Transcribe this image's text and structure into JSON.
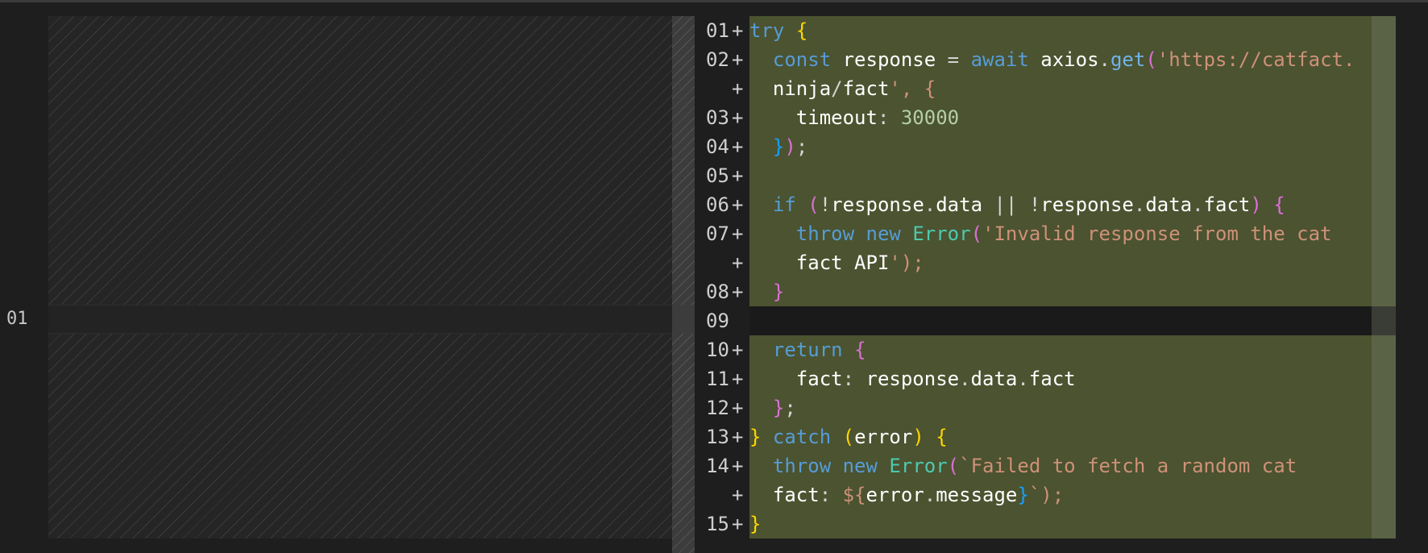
{
  "left_pane": {
    "line_number": "01"
  },
  "right_pane": {
    "lines": [
      {
        "num": "01",
        "marker": "+",
        "text": "try {"
      },
      {
        "num": "02",
        "marker": "+",
        "text": "  const response = await axios.get('https://catfact."
      },
      {
        "num": "",
        "marker": "+",
        "text": "  ninja/fact', {"
      },
      {
        "num": "03",
        "marker": "+",
        "text": "    timeout: 30000"
      },
      {
        "num": "04",
        "marker": "+",
        "text": "  });"
      },
      {
        "num": "05",
        "marker": "+",
        "text": ""
      },
      {
        "num": "06",
        "marker": "+",
        "text": "  if (!response.data || !response.data.fact) {"
      },
      {
        "num": "07",
        "marker": "+",
        "text": "    throw new Error('Invalid response from the cat"
      },
      {
        "num": "",
        "marker": "+",
        "text": "    fact API');"
      },
      {
        "num": "08",
        "marker": "+",
        "text": "  }"
      },
      {
        "num": "09",
        "marker": "",
        "text": ""
      },
      {
        "num": "10",
        "marker": "+",
        "text": "  return {"
      },
      {
        "num": "11",
        "marker": "+",
        "text": "    fact: response.data.fact"
      },
      {
        "num": "12",
        "marker": "+",
        "text": "  };"
      },
      {
        "num": "13",
        "marker": "+",
        "text": "} catch (error) {"
      },
      {
        "num": "14",
        "marker": "+",
        "text": "  throw new Error(`Failed to fetch a random cat"
      },
      {
        "num": "",
        "marker": "+",
        "text": "  fact: ${error.message}`);"
      },
      {
        "num": "15",
        "marker": "+",
        "text": "}"
      }
    ]
  },
  "colors": {
    "added_background": "#4b5330",
    "editor_background": "#1e1e1e",
    "keyword": "#569cd6",
    "string": "#ce9178",
    "class": "#4ec9b0",
    "number": "#b5cea8"
  }
}
